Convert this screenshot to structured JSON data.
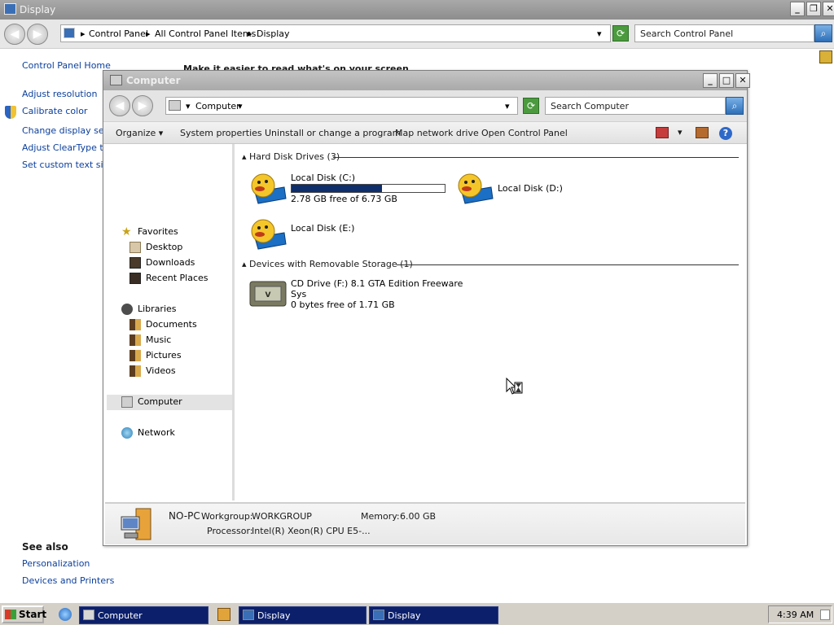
{
  "display_window": {
    "title": "Display",
    "breadcrumbs": [
      "Control Panel",
      "All Control Panel Items",
      "Display"
    ],
    "search_placeholder": "Search Control Panel",
    "left_links": [
      "Control Panel Home",
      "Adjust resolution",
      "Calibrate color",
      "Change display setti",
      "Adjust ClearType tex",
      "Set custom text size"
    ],
    "heading_partial": "Make it easier to read what's on your screen",
    "see_also": {
      "label": "See also",
      "links": [
        "Personalization",
        "Devices and Printers"
      ]
    }
  },
  "computer_window": {
    "title": "Computer",
    "breadcrumb": "Computer",
    "search_placeholder": "Search Computer",
    "toolbar": {
      "organize": "Organize",
      "system_properties": "System properties",
      "uninstall": "Uninstall or change a program",
      "map_drive": "Map network drive",
      "open_control_panel": "Open Control Panel"
    },
    "nav": {
      "favorites": "Favorites",
      "favorites_items": [
        "Desktop",
        "Downloads",
        "Recent Places"
      ],
      "libraries": "Libraries",
      "libraries_items": [
        "Documents",
        "Music",
        "Pictures",
        "Videos"
      ],
      "computer": "Computer",
      "network": "Network"
    },
    "groups": {
      "hdd_label": "Hard Disk Drives (3)",
      "removable_label": "Devices with Removable Storage (1)"
    },
    "drives": {
      "c": {
        "name": "Local Disk (C:)",
        "info": "2.78 GB free of 6.73 GB",
        "used_fraction": 0.59
      },
      "d": {
        "name": "Local Disk (D:)"
      },
      "e": {
        "name": "Local Disk (E:)"
      },
      "f": {
        "name": "CD Drive (F:) 8.1 GTA Edition Freeware",
        "sub": "Sys",
        "info": "0 bytes free of 1.71 GB"
      }
    },
    "details": {
      "pc_name": "NO-PC",
      "workgroup_label": "Workgroup:",
      "workgroup": "WORKGROUP",
      "memory_label": "Memory:",
      "memory": "6.00 GB",
      "processor_label": "Processor:",
      "processor": "Intel(R) Xeon(R) CPU E5-..."
    }
  },
  "taskbar": {
    "start": "Start",
    "tasks": [
      "Computer",
      "Display",
      "Display"
    ],
    "clock": "4:39 AM"
  },
  "colors": {
    "capacity_fill": "#0e2f6b",
    "task_active": "#0b1f6b",
    "link": "#0b3f9c"
  }
}
